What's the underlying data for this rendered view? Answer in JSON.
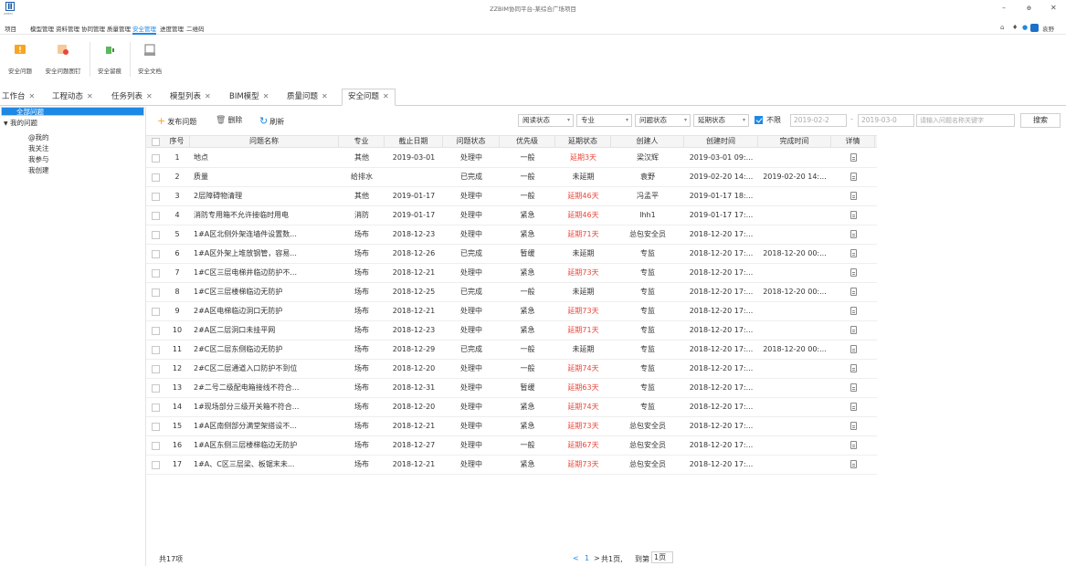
{
  "window": {
    "title": "ZZBIM协同平台-某综合广场项目",
    "logo_text": "ZZBIM"
  },
  "menu": {
    "items": [
      "项目",
      "模型管理",
      "资料管理",
      "协同管理",
      "质量管理",
      "安全管理",
      "进度管理",
      "二维码"
    ],
    "active": "安全管理",
    "user": "袁野"
  },
  "ribbon": {
    "buttons": [
      "安全问题",
      "安全问题图钉",
      "安全留痕",
      "安全文档"
    ]
  },
  "tabs": [
    {
      "label": "工作台"
    },
    {
      "label": "工程动态"
    },
    {
      "label": "任务列表"
    },
    {
      "label": "模型列表"
    },
    {
      "label": "BIM模型"
    },
    {
      "label": "质量问题"
    },
    {
      "label": "安全问题"
    }
  ],
  "tree": {
    "all": "全部问题",
    "mine": "我的问题",
    "children": [
      "@我的",
      "我关注",
      "我参与",
      "我创建"
    ]
  },
  "toolbar": {
    "publish": "发布问题",
    "delete": "删除",
    "refresh": "刷新",
    "filters": [
      "阅读状态",
      "专业",
      "问题状态",
      "延期状态"
    ],
    "unlimited": "不限",
    "date_from": "2019-02-2",
    "date_to": "2019-03-0",
    "date_sep": "-",
    "search_placeholder": "请输入问题名称关键字",
    "search": "搜索"
  },
  "table": {
    "columns": [
      "序号",
      "问题名称",
      "专业",
      "截止日期",
      "问题状态",
      "优先级",
      "延期状态",
      "创建人",
      "创建时间",
      "完成时间",
      "详情"
    ],
    "rows": [
      [
        "1",
        "地点",
        "其他",
        "2019-03-01",
        "处理中",
        "一般",
        "延期3天",
        "梁汉辉",
        "2019-03-01 09:...",
        ""
      ],
      [
        "2",
        "质量",
        "给排水",
        "",
        "已完成",
        "一般",
        "未延期",
        "袁野",
        "2019-02-20 14:...",
        "2019-02-20 14:..."
      ],
      [
        "3",
        "2层障碍物清理",
        "其他",
        "2019-01-17",
        "处理中",
        "一般",
        "延期46天",
        "冯孟平",
        "2019-01-17 18:...",
        ""
      ],
      [
        "4",
        "消防专用箱不允许接临时用电",
        "消防",
        "2019-01-17",
        "处理中",
        "紧急",
        "延期46天",
        "lhh1",
        "2019-01-17 17:...",
        ""
      ],
      [
        "5",
        "1#A区北侧外架连墙件设置数...",
        "场布",
        "2018-12-23",
        "处理中",
        "紧急",
        "延期71天",
        "总包安全员",
        "2018-12-20 17:...",
        ""
      ],
      [
        "6",
        "1#A区外架上堆放钢管，容易...",
        "场布",
        "2018-12-26",
        "已完成",
        "暂缓",
        "未延期",
        "专监",
        "2018-12-20 17:...",
        "2018-12-20 00:..."
      ],
      [
        "7",
        "1#C区三层电梯井临边防护不...",
        "场布",
        "2018-12-21",
        "处理中",
        "紧急",
        "延期73天",
        "专监",
        "2018-12-20 17:...",
        ""
      ],
      [
        "8",
        "1#C区三层楼梯临边无防护",
        "场布",
        "2018-12-25",
        "已完成",
        "一般",
        "未延期",
        "专监",
        "2018-12-20 17:...",
        "2018-12-20 00:..."
      ],
      [
        "9",
        "2#A区电梯临边洞口无防护",
        "场布",
        "2018-12-21",
        "处理中",
        "紧急",
        "延期73天",
        "专监",
        "2018-12-20 17:...",
        ""
      ],
      [
        "10",
        "2#A区二层洞口未挂平网",
        "场布",
        "2018-12-23",
        "处理中",
        "紧急",
        "延期71天",
        "专监",
        "2018-12-20 17:...",
        ""
      ],
      [
        "11",
        "2#C区二层东侧临边无防护",
        "场布",
        "2018-12-29",
        "已完成",
        "一般",
        "未延期",
        "专监",
        "2018-12-20 17:...",
        "2018-12-20 00:..."
      ],
      [
        "12",
        "2#C区二层通道入口防护不到位",
        "场布",
        "2018-12-20",
        "处理中",
        "一般",
        "延期74天",
        "专监",
        "2018-12-20 17:...",
        ""
      ],
      [
        "13",
        "2#二号二级配电箱接线不符合...",
        "场布",
        "2018-12-31",
        "处理中",
        "暂缓",
        "延期63天",
        "专监",
        "2018-12-20 17:...",
        ""
      ],
      [
        "14",
        "1#现场部分三级开关箱不符合...",
        "场布",
        "2018-12-20",
        "处理中",
        "紧急",
        "延期74天",
        "专监",
        "2018-12-20 17:...",
        ""
      ],
      [
        "15",
        "1#A区南侧部分满堂架搭设不...",
        "场布",
        "2018-12-21",
        "处理中",
        "紧急",
        "延期73天",
        "总包安全员",
        "2018-12-20 17:...",
        ""
      ],
      [
        "16",
        "1#A区东侧三层楼梯临边无防护",
        "场布",
        "2018-12-27",
        "处理中",
        "一般",
        "延期67天",
        "总包安全员",
        "2018-12-20 17:...",
        ""
      ],
      [
        "17",
        "1#A、C区三层梁、板锯末未...",
        "场布",
        "2018-12-21",
        "处理中",
        "紧急",
        "延期73天",
        "总包安全员",
        "2018-12-20 17:...",
        ""
      ]
    ]
  },
  "footer": {
    "total": "共17项",
    "prev": "<",
    "page": "1",
    "next": ">",
    "pages": "共1页,",
    "goto": "到第",
    "goto_value": "1页"
  },
  "colors": {
    "accent": "#1e88e5",
    "overdue": "#e8473b"
  }
}
